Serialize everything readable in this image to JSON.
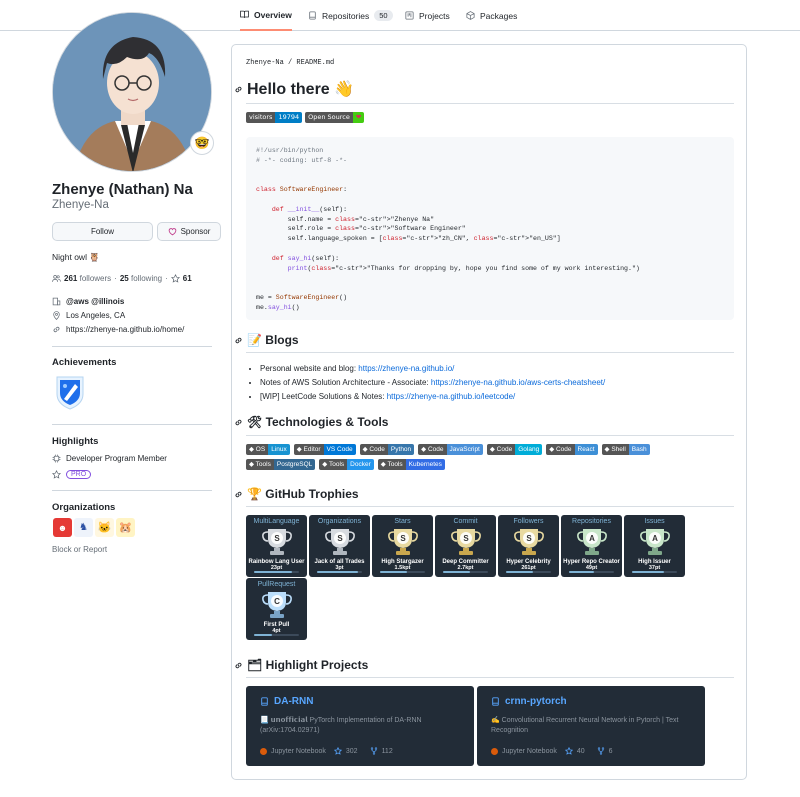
{
  "nav": {
    "tabs": [
      {
        "label": "Overview",
        "icon": "book-icon"
      },
      {
        "label": "Repositories",
        "count": "50",
        "icon": "repo-icon"
      },
      {
        "label": "Projects",
        "icon": "project-icon"
      },
      {
        "label": "Packages",
        "icon": "package-icon"
      }
    ]
  },
  "profile": {
    "fullname": "Zhenye (Nathan) Na",
    "username": "Zhenye-Na",
    "follow_label": "Follow",
    "sponsor_label": "Sponsor",
    "bio": "Night owl 🦉",
    "followers": "261",
    "followers_label": "followers",
    "following": "25",
    "following_label": "following",
    "stars": "61",
    "company": "@aws @illinois",
    "location": "Los Angeles, CA",
    "website": "https://zhenye-na.github.io/home/"
  },
  "achievements": {
    "heading": "Achievements"
  },
  "highlights": {
    "heading": "Highlights",
    "items": [
      "Developer Program Member"
    ],
    "pro_label": "PRO"
  },
  "organizations": {
    "heading": "Organizations"
  },
  "block_report": "Block or Report",
  "readme": {
    "path_user": "Zhenye-Na",
    "path_sep": " / ",
    "path_file": "README.md",
    "title": "Hello there 👋",
    "badges": [
      {
        "left": "visitors",
        "right": "19794",
        "color": "#007ec6"
      },
      {
        "left": "Open Source",
        "right": "❤",
        "color": "#4c1"
      }
    ],
    "code_lines": [
      "#!/usr/bin/python",
      "# -*- coding: utf-8 -*-",
      "",
      "",
      "class SoftwareEngineer:",
      "",
      "    def __init__(self):",
      "        self.name = \"Zhenye Na\"",
      "        self.role = \"Software Engineer\"",
      "        self.language_spoken = [\"zh_CN\", \"en_US\"]",
      "",
      "    def say_hi(self):",
      "        print(\"Thanks for dropping by, hope you find some of my work interesting.\")",
      "",
      "",
      "me = SoftwareEngineer()",
      "me.say_hi()"
    ],
    "blogs_heading": "📝 Blogs",
    "blogs": [
      {
        "text": "Personal website and blog: ",
        "link": "https://zhenye-na.github.io/"
      },
      {
        "text": "Notes of AWS Solution Architecture - Associate: ",
        "link": "https://zhenye-na.github.io/aws-certs-cheatsheet/"
      },
      {
        "text": "[WIP] LeetCode Solutions & Notes: ",
        "link": "https://zhenye-na.github.io/leetcode/"
      }
    ],
    "tech_heading": "🛠 Technologies & Tools",
    "tech_row1": [
      {
        "left": "OS",
        "right": "Linux",
        "color": "#1793d1"
      },
      {
        "left": "Editor",
        "right": "VS Code",
        "color": "#0078d7"
      },
      {
        "left": "Code",
        "right": "Python",
        "color": "#3776ab"
      },
      {
        "left": "Code",
        "right": "JavaScript",
        "color": "#4a90d9"
      },
      {
        "left": "Code",
        "right": "Golang",
        "color": "#00add8"
      },
      {
        "left": "Code",
        "right": "React",
        "color": "#3d8fd6"
      },
      {
        "left": "Shell",
        "right": "Bash",
        "color": "#4a90d9"
      }
    ],
    "tech_row2": [
      {
        "left": "Tools",
        "right": "PostgreSQL",
        "color": "#336791"
      },
      {
        "left": "Tools",
        "right": "Docker",
        "color": "#2496ed"
      },
      {
        "left": "Tools",
        "right": "Kubernetes",
        "color": "#326ce5"
      }
    ],
    "trophies_heading": "🏆 GitHub Trophies",
    "trophies": [
      {
        "title": "MultiLanguage",
        "rank": "S",
        "name": "Rainbow Lang User",
        "pt": "23pt",
        "progress": 0.85
      },
      {
        "title": "Organizations",
        "rank": "S",
        "name": "Jack of all Trades",
        "pt": "3pt",
        "progress": 0.9
      },
      {
        "title": "Stars",
        "rank": "S",
        "name": "High Stargazer",
        "pt": "1.5kpt",
        "progress": 0.6
      },
      {
        "title": "Commit",
        "rank": "S",
        "name": "Deep Committer",
        "pt": "2.7kpt",
        "progress": 0.6
      },
      {
        "title": "Followers",
        "rank": "S",
        "name": "Hyper Celebrity",
        "pt": "261pt",
        "progress": 0.6
      },
      {
        "title": "Repositories",
        "rank": "A",
        "name": "Hyper Repo Creator",
        "pt": "49pt",
        "progress": 0.55
      },
      {
        "title": "Issues",
        "rank": "A",
        "name": "High Issuer",
        "pt": "37pt",
        "progress": 0.7
      },
      {
        "title": "PullRequest",
        "rank": "C",
        "name": "First Pull",
        "pt": "4pt",
        "progress": 0.4
      }
    ],
    "projects_heading": "🗂 Highlight Projects",
    "projects": [
      {
        "name": "DA-RNN",
        "desc": "📃 𝘂𝗻𝗼𝗳𝗳𝗶𝗰𝗶𝗮𝗹 PyTorch Implementation of DA-RNN (arXiv:1704.02971)",
        "lang": "Jupyter Notebook",
        "stars": "302",
        "forks": "112"
      },
      {
        "name": "crnn-pytorch",
        "desc": "✍️ Convolutional Recurrent Neural Network in Pytorch | Text Recognition",
        "lang": "Jupyter Notebook",
        "stars": "40",
        "forks": "6"
      }
    ]
  }
}
